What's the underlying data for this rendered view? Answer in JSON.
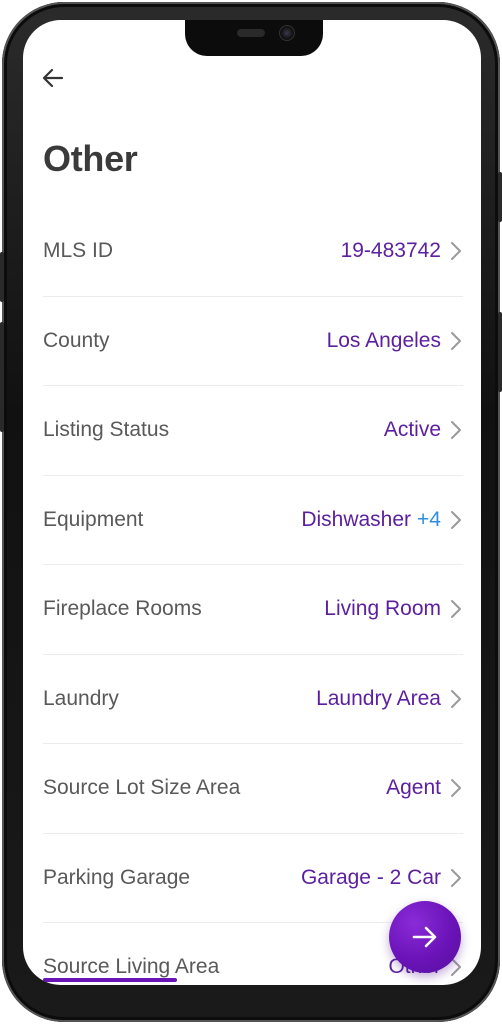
{
  "header": {
    "back_icon": "arrow-left-icon",
    "title": "Other"
  },
  "rows": [
    {
      "label": "MLS ID",
      "value": "19-483742",
      "extra": ""
    },
    {
      "label": "County",
      "value": "Los Angeles",
      "extra": ""
    },
    {
      "label": "Listing Status",
      "value": "Active",
      "extra": ""
    },
    {
      "label": "Equipment",
      "value": "Dishwasher",
      "extra": "+4"
    },
    {
      "label": "Fireplace Rooms",
      "value": "Living Room",
      "extra": ""
    },
    {
      "label": "Laundry",
      "value": "Laundry Area",
      "extra": ""
    },
    {
      "label": "Source Lot Size Area",
      "value": "Agent",
      "extra": ""
    },
    {
      "label": "Parking Garage",
      "value": "Garage - 2 Car",
      "extra": ""
    },
    {
      "label": "Source Living Area",
      "value": "Other",
      "extra": ""
    }
  ],
  "fab": {
    "icon": "arrow-right-icon"
  },
  "colors": {
    "accent": "#6a13b8",
    "value_text": "#5b1fa0",
    "extra_text": "#2f8ee0",
    "label_text": "#595959"
  }
}
